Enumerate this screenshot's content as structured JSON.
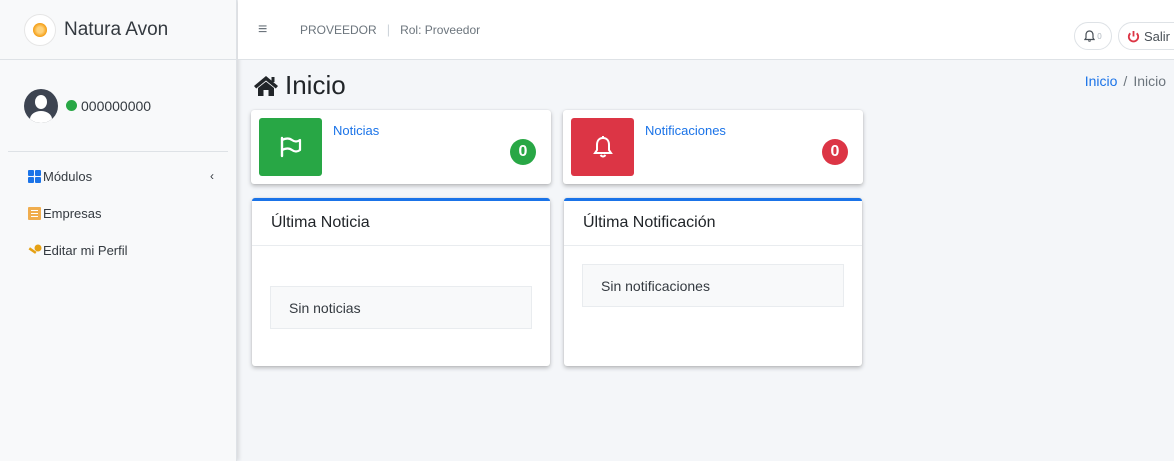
{
  "brand": {
    "name": "Natura Avon",
    "logo_text": "natura"
  },
  "user": {
    "name": "000000000",
    "status_color": "#28a745"
  },
  "sidebar": {
    "items": [
      {
        "label": "Módulos",
        "icon": "grid-icon",
        "has_chevron": true
      },
      {
        "label": "Empresas",
        "icon": "building-icon"
      },
      {
        "label": "Editar mi Perfil",
        "icon": "key-icon"
      }
    ]
  },
  "topbar": {
    "menu_icon": "≡",
    "provider": "PROVEEDOR",
    "separator": "|",
    "role": "Rol: Proveedor",
    "notifications_count": "0",
    "logout_label": "Salir"
  },
  "page": {
    "title": "Inicio"
  },
  "breadcrumb": {
    "items": [
      "Inicio",
      "Inicio"
    ],
    "separator": "/"
  },
  "info_boxes": [
    {
      "label": "Noticias",
      "count": "0",
      "icon": "flag-icon",
      "color": "#28a745"
    },
    {
      "label": "Notificaciones",
      "count": "0",
      "icon": "bell-icon",
      "color": "#dc3545"
    }
  ],
  "cards": [
    {
      "title": "Última Noticia",
      "empty_text": "Sin noticias"
    },
    {
      "title": "Última Notificación",
      "empty_text": "Sin notificaciones"
    }
  ],
  "colors": {
    "primary": "#1a73e8",
    "success": "#28a745",
    "danger": "#dc3545",
    "background": "#f4f6f9"
  }
}
